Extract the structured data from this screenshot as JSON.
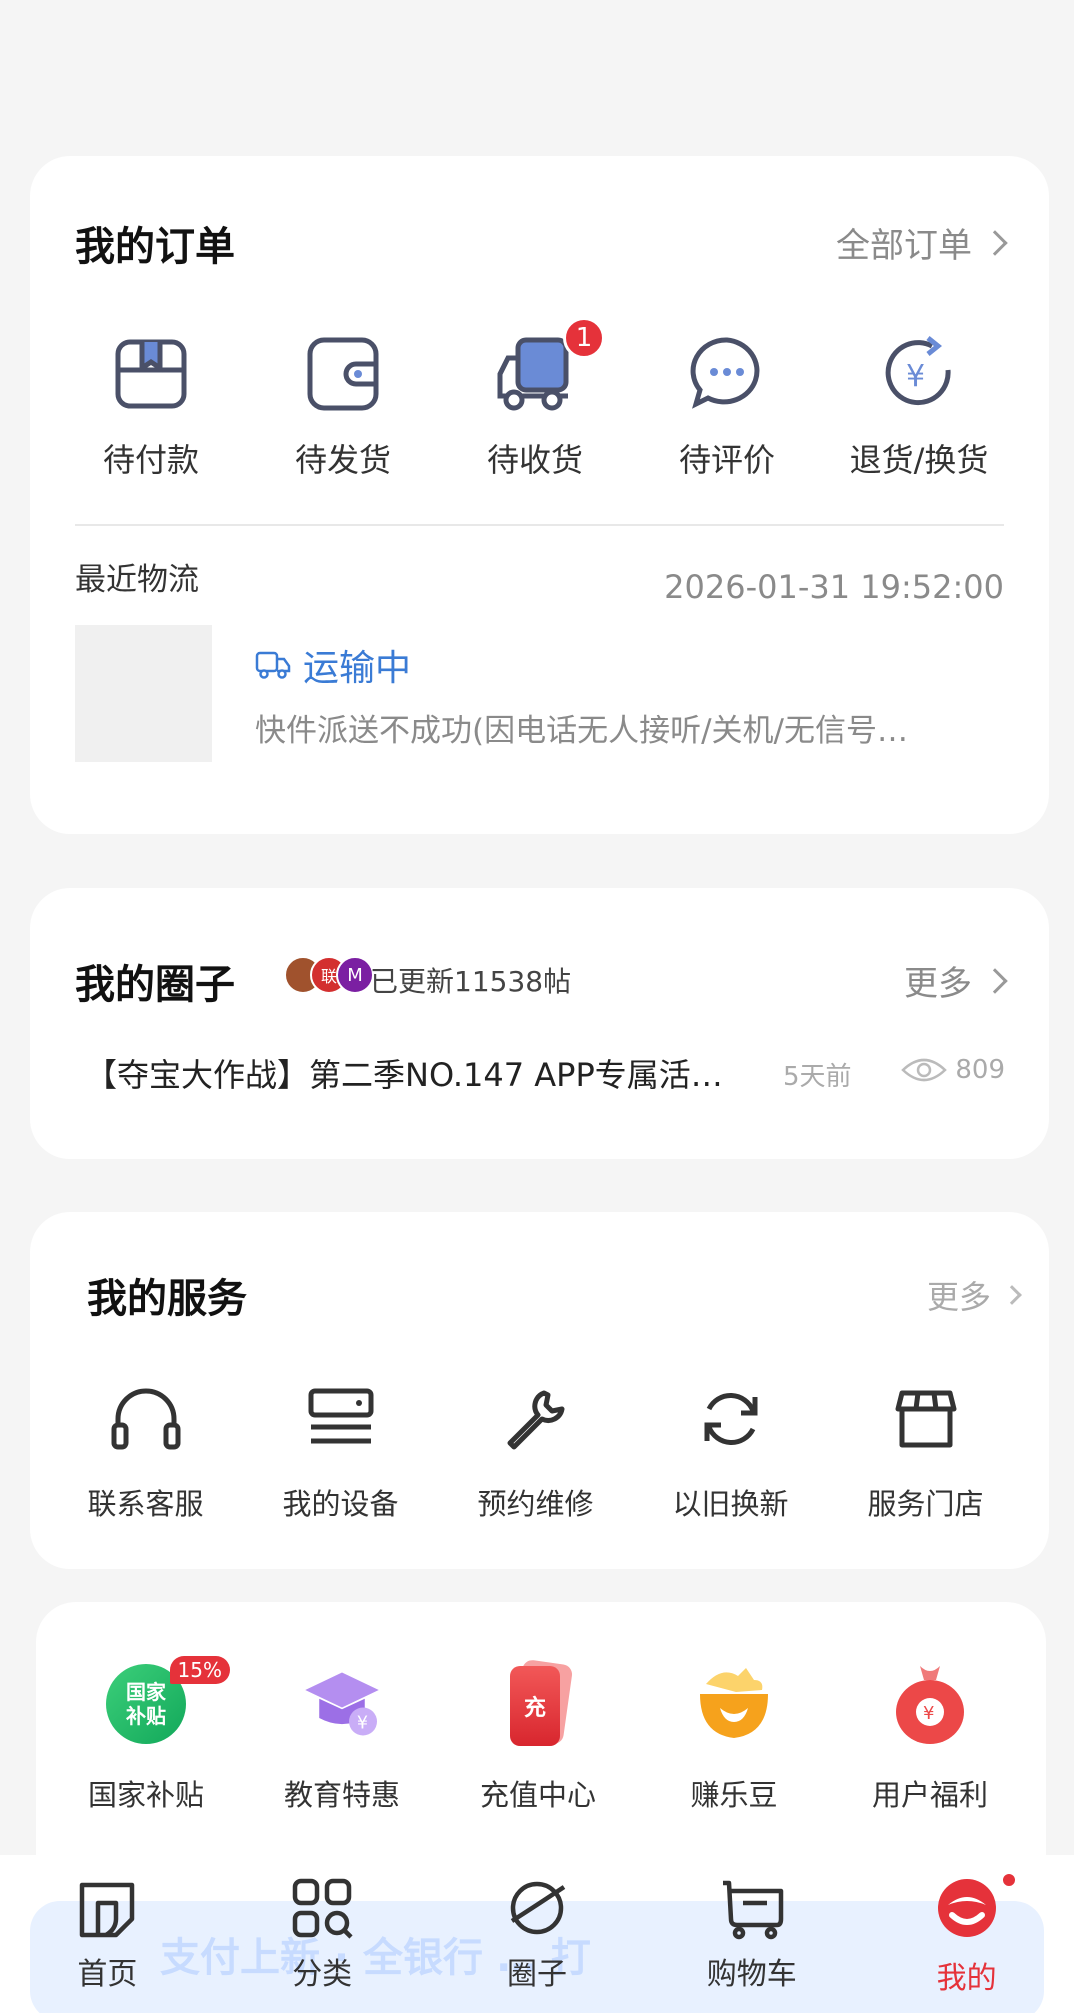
{
  "orders": {
    "title": "我的订单",
    "all_orders_label": "全部订单",
    "items": [
      {
        "icon": "pending-payment-icon",
        "label": "待付款"
      },
      {
        "icon": "pending-shipment-icon",
        "label": "待发货"
      },
      {
        "icon": "pending-receipt-icon",
        "label": "待收货",
        "badge": "1"
      },
      {
        "icon": "pending-review-icon",
        "label": "待评价"
      },
      {
        "icon": "refund-icon",
        "label": "退货/换货"
      }
    ],
    "logistics": {
      "label": "最近物流",
      "timestamp": "2026-01-31 19:52:00",
      "status": "运输中",
      "description": "快件派送不成功(因电话无人接听/关机/无信号…"
    }
  },
  "circle": {
    "title": "我的圈子",
    "update_text": "已更新11538帖",
    "more_label": "更多",
    "post_title": "【夺宝大作战】第二季NO.147 APP专属活…",
    "post_time": "5天前",
    "post_views": "809"
  },
  "services": {
    "title": "我的服务",
    "more_label": "更多",
    "items": [
      {
        "icon": "headset-icon",
        "label": "联系客服"
      },
      {
        "icon": "device-icon",
        "label": "我的设备"
      },
      {
        "icon": "wrench-icon",
        "label": "预约维修"
      },
      {
        "icon": "refresh-icon",
        "label": "以旧换新"
      },
      {
        "icon": "store-icon",
        "label": "服务门店"
      }
    ]
  },
  "benefits": {
    "items": [
      {
        "icon": "national-subsidy-icon",
        "label": "国家补贴",
        "badge": "15%",
        "icon_text": "国家\n补贴"
      },
      {
        "icon": "education-icon",
        "label": "教育特惠"
      },
      {
        "icon": "recharge-icon",
        "label": "充值中心",
        "icon_text": "充"
      },
      {
        "icon": "beans-icon",
        "label": "赚乐豆"
      },
      {
        "icon": "welfare-icon",
        "label": "用户福利"
      }
    ]
  },
  "banner": {
    "text": "支付上新 ·  全银行 … 打"
  },
  "nav": {
    "items": [
      {
        "icon": "home-icon",
        "label": "首页"
      },
      {
        "icon": "category-icon",
        "label": "分类"
      },
      {
        "icon": "circle-icon",
        "label": "圈子"
      },
      {
        "icon": "cart-icon",
        "label": "购物车"
      },
      {
        "icon": "profile-icon",
        "label": "我的",
        "active": true
      }
    ]
  },
  "colors": {
    "accent": "#e5323a",
    "link": "#3a7bd5",
    "icon": "#4a5068"
  }
}
